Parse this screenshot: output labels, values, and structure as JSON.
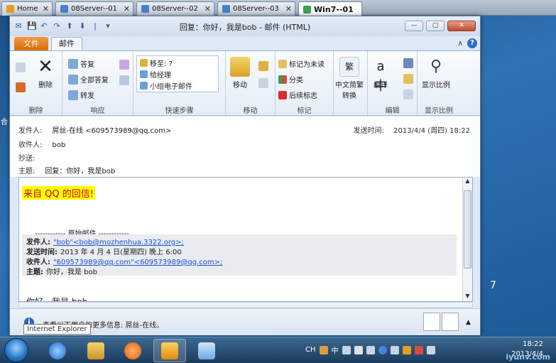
{
  "tabs": [
    {
      "label": "Home",
      "color": "#e0a020"
    },
    {
      "label": "08Server--01",
      "color": "#4a80c8"
    },
    {
      "label": "08Server--02",
      "color": "#4a80c8"
    },
    {
      "label": "08Server--03",
      "color": "#4a80c8"
    },
    {
      "label": "Win7--01",
      "color": "#3aa05a",
      "active": true
    }
  ],
  "window": {
    "title": "回复：你好，我是bob - 邮件 (HTML)",
    "qat": [
      "✉",
      "💾",
      "↶",
      "↷",
      "⬆",
      "⬇",
      "|",
      "▾"
    ],
    "btn_min": "—",
    "btn_max": "▢",
    "btn_close": "✕"
  },
  "ribbon": {
    "file_tab": "文件",
    "mail_tab": "邮件",
    "help": "?",
    "groups": {
      "delete": {
        "label": "删除",
        "delete_btn": "删除"
      },
      "respond": {
        "label": "响应",
        "reply": "答复",
        "reply_all": "全部答复",
        "forward": "转发"
      },
      "quicksteps": {
        "label": "快速步骤",
        "items": [
          "移至: ?",
          "给经理",
          "小组电子邮件"
        ]
      },
      "move": {
        "label": "移动",
        "move_btn": "移动"
      },
      "tags": {
        "label": "标记",
        "mark_unread": "标记为未读",
        "categorize": "分类",
        "followup": "后续标志"
      },
      "chinese": {
        "convert": "中文简繁",
        "convert2": "转换"
      },
      "edit": {
        "label": "编辑",
        "translate": "翻译"
      },
      "zoom": {
        "label": "显示比例",
        "zoom_btn": "显示比例"
      }
    }
  },
  "header": {
    "from_label": "发件人:",
    "from_value": "屌丝-在线 <609573989@qq.com>",
    "to_label": "收件人:",
    "to_value": "bob",
    "cc_label": "抄送:",
    "cc_value": "",
    "subject_label": "主题:",
    "subject_value": "回复：你好，我是bob",
    "sent_label": "发送时间:",
    "sent_value": "2013/4/4 (周四) 18:22"
  },
  "body": {
    "highlight": "来自 QQ 的回信!",
    "orig_sep": "------------ 原始邮件 ------------",
    "q_from_label": "发件人:",
    "q_from_value": "\"bob\"<bob@mozhenhua.3322.org>;",
    "q_time_label": "发送时间:",
    "q_time_value": "2013 年 4 月 4 日(星期四) 晚上 6:00",
    "q_to_label": "收件人:",
    "q_to_value": "\"609573989@qq.com\"<609573989@qq.com>;",
    "q_subj_label": "主题:",
    "q_subj_value": "你好，我是 bob",
    "cut_text": "你好，我是 bob"
  },
  "people_pane": {
    "text": "查看以下用户的更多信息: 屌丝-在线。"
  },
  "tooltip": "Internet Explorer",
  "taskbar": {
    "tray_lang": "CH",
    "tray_ime": "中",
    "time": "18:22",
    "date": "2013/4/4",
    "watermark": "iyunv.com"
  },
  "desktop": {
    "right_frag": "7",
    "left_frag": "合"
  }
}
